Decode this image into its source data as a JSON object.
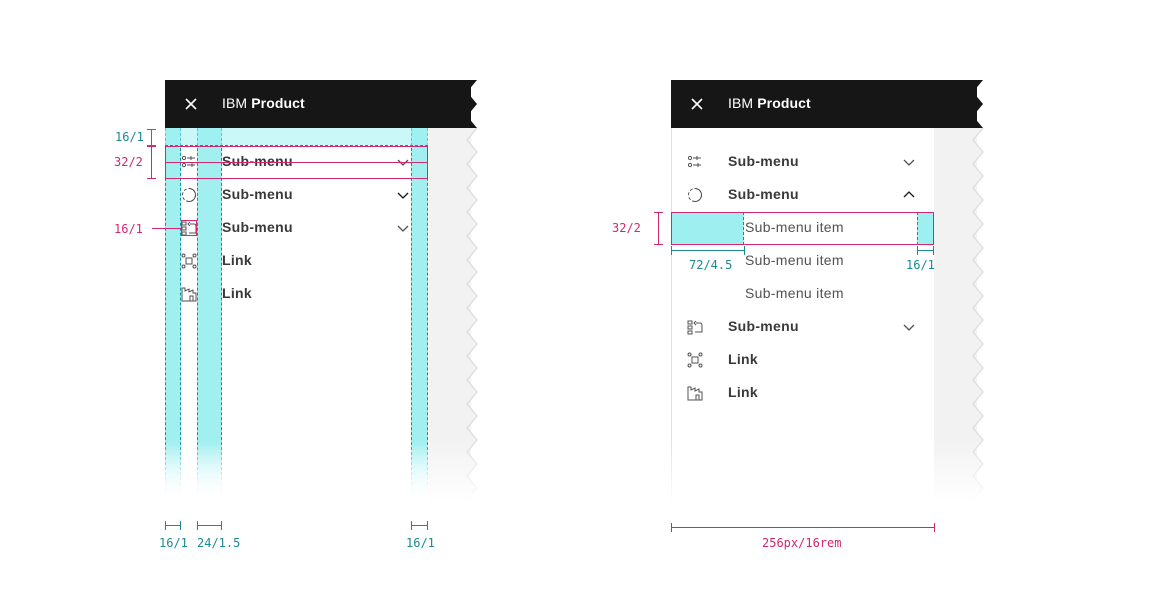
{
  "colors": {
    "header_bg": "#161616",
    "spec_cyan": "#9ef0f0",
    "spec_teal": "#1a8a94",
    "spec_pink": "#d12771",
    "panel_bg": "#f2f2f2"
  },
  "left_panel": {
    "header": {
      "close_icon": "close-icon",
      "brand_prefix": "IBM",
      "brand_name": "Product"
    },
    "items": [
      {
        "icon": "settings-adjust-icon",
        "label": "Sub-menu",
        "chevron": "chevron-down"
      },
      {
        "icon": "incomplete-circle-icon",
        "label": "Sub-menu",
        "chevron": "chevron-down"
      },
      {
        "icon": "data-return-icon",
        "label": "Sub-menu",
        "chevron": "chevron-down"
      },
      {
        "icon": "network-icon",
        "label": "Link"
      },
      {
        "icon": "industry-icon",
        "label": "Link"
      }
    ],
    "annotations": {
      "top_spacing": "16/1",
      "item_height": "32/2",
      "icon_size": "16/1",
      "left_margin": "16/1",
      "icon_gap": "24/1.5",
      "right_margin": "16/1"
    }
  },
  "right_panel": {
    "header": {
      "close_icon": "close-icon",
      "brand_prefix": "IBM",
      "brand_name": "Product"
    },
    "items": [
      {
        "icon": "settings-adjust-icon",
        "label": "Sub-menu",
        "chevron": "chevron-down"
      },
      {
        "icon": "incomplete-circle-icon",
        "label": "Sub-menu",
        "chevron": "chevron-up"
      },
      {
        "label": "Sub-menu item",
        "sub": true
      },
      {
        "label": "Sub-menu item",
        "sub": true
      },
      {
        "label": "Sub-menu item",
        "sub": true
      },
      {
        "icon": "data-return-icon",
        "label": "Sub-menu",
        "chevron": "chevron-down"
      },
      {
        "icon": "network-icon",
        "label": "Link"
      },
      {
        "icon": "industry-icon",
        "label": "Link"
      }
    ],
    "annotations": {
      "item_height": "32/2",
      "sub_indent": "72/4.5",
      "right_margin": "16/1",
      "panel_width": "256px/16rem"
    }
  }
}
